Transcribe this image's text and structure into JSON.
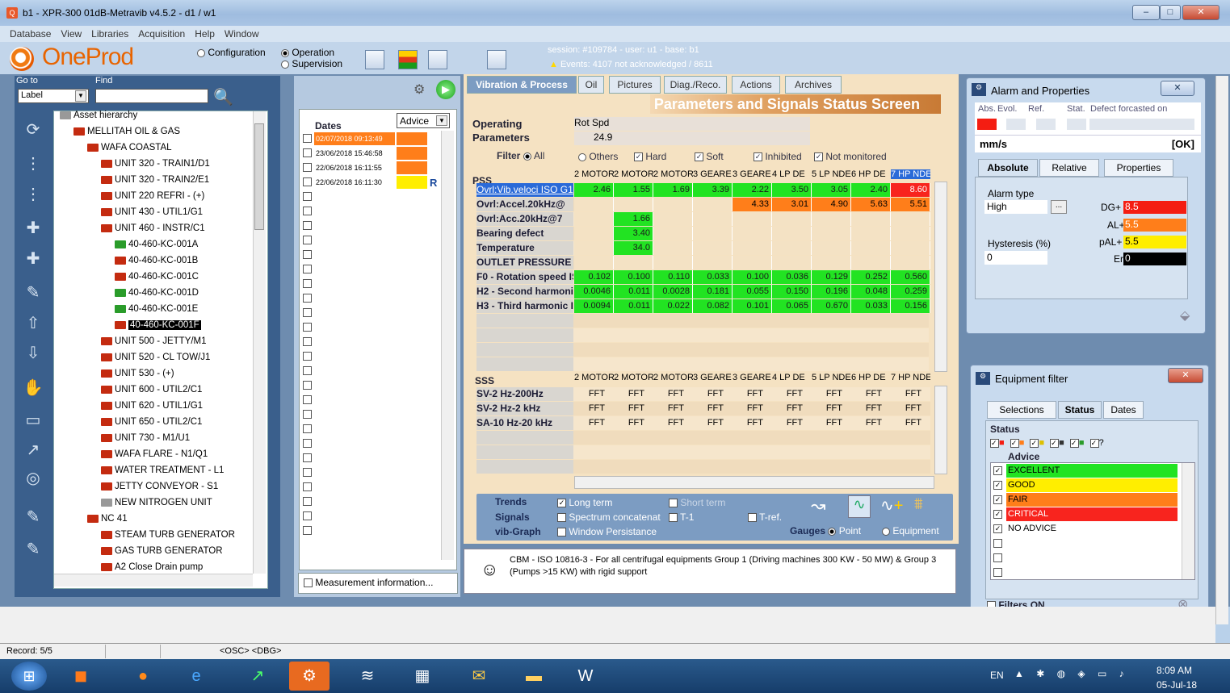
{
  "window": {
    "title": "b1 - XPR-300 01dB-Metravib v4.5.2 - d1 / w1"
  },
  "menu": [
    "Database",
    "View",
    "Libraries",
    "Acquisition",
    "Help",
    "Window"
  ],
  "logo": "OneProd",
  "mode": {
    "configuration": "Configuration",
    "operation": "Operation",
    "supervision": "Supervision"
  },
  "session": {
    "info": "session: #109784 - user: u1 - base: b1",
    "events": "Events: 4107 not acknowledged / 8611"
  },
  "goto": {
    "label": "Go to",
    "find": "Find",
    "select": "Label"
  },
  "tree": [
    {
      "label": "Asset hierarchy",
      "indent": 0,
      "color": "#999"
    },
    {
      "label": "MELLITAH OIL & GAS",
      "indent": 1,
      "color": "#c42b10"
    },
    {
      "label": "WAFA COASTAL",
      "indent": 2,
      "color": "#c42b10"
    },
    {
      "label": "UNIT 320 - TRAIN1/D1",
      "indent": 3,
      "color": "#c42b10"
    },
    {
      "label": "UNIT 320 - TRAIN2/E1",
      "indent": 3,
      "color": "#c42b10"
    },
    {
      "label": "UNIT 220 REFRI - (+)",
      "indent": 3,
      "color": "#c42b10"
    },
    {
      "label": "UNIT 430 - UTIL1/G1",
      "indent": 3,
      "color": "#c42b10"
    },
    {
      "label": "UNIT 460 - INSTR/C1",
      "indent": 3,
      "color": "#c42b10"
    },
    {
      "label": "40-460-KC-001A",
      "indent": 4,
      "color": "#2a9c2a"
    },
    {
      "label": "40-460-KC-001B",
      "indent": 4,
      "color": "#c42b10"
    },
    {
      "label": "40-460-KC-001C",
      "indent": 4,
      "color": "#c42b10"
    },
    {
      "label": "40-460-KC-001D",
      "indent": 4,
      "color": "#2a9c2a"
    },
    {
      "label": "40-460-KC-001E",
      "indent": 4,
      "color": "#2a9c2a"
    },
    {
      "label": "40-460-KC-001F",
      "indent": 4,
      "color": "#c42b10",
      "selected": true
    },
    {
      "label": "UNIT 500 - JETTY/M1",
      "indent": 3,
      "color": "#c42b10"
    },
    {
      "label": "UNIT 520 - CL TOW/J1",
      "indent": 3,
      "color": "#c42b10"
    },
    {
      "label": "UNIT 530 - (+)",
      "indent": 3,
      "color": "#c42b10"
    },
    {
      "label": "UNIT 600 - UTIL2/C1",
      "indent": 3,
      "color": "#c42b10"
    },
    {
      "label": "UNIT 620 - UTIL1/G1",
      "indent": 3,
      "color": "#c42b10"
    },
    {
      "label": "UNIT 650 - UTIL2/C1",
      "indent": 3,
      "color": "#c42b10"
    },
    {
      "label": "UNIT 730 - M1/U1",
      "indent": 3,
      "color": "#c42b10"
    },
    {
      "label": "WAFA FLARE - N1/Q1",
      "indent": 3,
      "color": "#c42b10"
    },
    {
      "label": "WATER TREATMENT - L1",
      "indent": 3,
      "color": "#c42b10"
    },
    {
      "label": "JETTY CONVEYOR - S1",
      "indent": 3,
      "color": "#c42b10"
    },
    {
      "label": "NEW NITROGEN UNIT",
      "indent": 3,
      "color": "#999"
    },
    {
      "label": "NC 41",
      "indent": 2,
      "color": "#c42b10"
    },
    {
      "label": "STEAM TURB GENERATOR",
      "indent": 3,
      "color": "#c42b10"
    },
    {
      "label": "GAS TURB GENERATOR",
      "indent": 3,
      "color": "#c42b10"
    },
    {
      "label": "A2 Close Drain pump",
      "indent": 3,
      "color": "#c42b10"
    }
  ],
  "dates": {
    "header": "Dates",
    "advice": "Advice",
    "rows": [
      {
        "date": "02/07/2018 09:13:49",
        "color": "#ff7e1a",
        "selected": true
      },
      {
        "date": "23/06/2018 15:46:58",
        "color": "#ff7e1a"
      },
      {
        "date": "22/06/2018 16:11:55",
        "color": "#ff7e1a"
      },
      {
        "date": "22/06/2018 16:11:30",
        "color": "#ffee00",
        "mark": "R"
      }
    ],
    "measurement_info": "Measurement information..."
  },
  "tabs": [
    "Vibration & Process",
    "Oil",
    "Pictures",
    "Diag./Reco.",
    "Actions",
    "Archives"
  ],
  "screen_title": "Parameters and Signals Status Screen",
  "operating": {
    "label1": "Operating",
    "label2": "Parameters",
    "param": "Rot Spd",
    "value": "24.9"
  },
  "filter": {
    "label": "Filter",
    "all": "All",
    "others": "Others",
    "hard": "Hard",
    "soft": "Soft",
    "inhibited": "Inhibited",
    "not_monitored": "Not monitored"
  },
  "pss": {
    "label": "PSS",
    "columns": [
      "2 MOTOR",
      "2 MOTOR",
      "2 MOTOR",
      "3 GEARE",
      "3 GEARE",
      "4 LP DE",
      "5 LP NDE",
      "6 HP DE",
      "7 HP NDE"
    ],
    "rows": [
      {
        "label": "Ovrl:Vib.veloci ISO G1",
        "values": [
          "2.46",
          "1.55",
          "1.69",
          "3.39",
          "2.22",
          "3.50",
          "3.05",
          "2.40",
          "8.60"
        ],
        "classes": [
          "g",
          "g",
          "g",
          "g",
          "g",
          "g",
          "g",
          "g",
          "r"
        ]
      },
      {
        "label": "Ovrl:Accel.20kHz@",
        "values": [
          "",
          "",
          "",
          "",
          "4.33",
          "3.01",
          "4.90",
          "5.63",
          "5.51"
        ],
        "classes": [
          "",
          "",
          "",
          "",
          "o",
          "o",
          "o",
          "o",
          "o"
        ]
      },
      {
        "label": "Ovrl:Acc.20kHz@7",
        "values": [
          "",
          "1.66",
          "",
          "",
          "",
          "",
          "",
          "",
          ""
        ],
        "classes": [
          "",
          "g",
          "",
          "",
          "",
          "",
          "",
          "",
          ""
        ]
      },
      {
        "label": "Bearing defect",
        "values": [
          "",
          "3.40",
          "",
          "",
          "",
          "",
          "",
          "",
          ""
        ],
        "classes": [
          "",
          "g",
          "",
          "",
          "",
          "",
          "",
          "",
          ""
        ]
      },
      {
        "label": "Temperature",
        "values": [
          "",
          "34.0",
          "",
          "",
          "",
          "",
          "",
          "",
          ""
        ],
        "classes": [
          "",
          "g",
          "",
          "",
          "",
          "",
          "",
          "",
          ""
        ]
      },
      {
        "label": "OUTLET PRESSURE",
        "values": [
          "",
          "",
          "",
          "",
          "",
          "",
          "",
          "",
          ""
        ],
        "classes": [
          "",
          "",
          "",
          "",
          "",
          "",
          "",
          "",
          ""
        ]
      },
      {
        "label": "F0 - Rotation speed IS",
        "values": [
          "0.102",
          "0.100",
          "0.110",
          "0.033",
          "0.100",
          "0.036",
          "0.129",
          "0.252",
          "0.560"
        ],
        "classes": [
          "g",
          "g",
          "g",
          "g",
          "g",
          "g",
          "g",
          "g",
          "g"
        ]
      },
      {
        "label": "H2 - Second harmonic",
        "values": [
          "0.0046",
          "0.011",
          "0.0028",
          "0.181",
          "0.055",
          "0.150",
          "0.196",
          "0.048",
          "0.259"
        ],
        "classes": [
          "g",
          "g",
          "g",
          "g",
          "g",
          "g",
          "g",
          "g",
          "g"
        ]
      },
      {
        "label": "H3 - Third harmonic IS",
        "values": [
          "0.0094",
          "0.011",
          "0.022",
          "0.082",
          "0.101",
          "0.065",
          "0.670",
          "0.033",
          "0.156"
        ],
        "classes": [
          "g",
          "g",
          "g",
          "g",
          "g",
          "g",
          "g",
          "g",
          "g"
        ]
      }
    ]
  },
  "sss": {
    "label": "SSS",
    "rows": [
      {
        "label": "SV-2 Hz-200Hz",
        "value": "FFT"
      },
      {
        "label": "SV-2 Hz-2 kHz",
        "value": "FFT"
      },
      {
        "label": "SA-10 Hz-20 kHz",
        "value": "FFT"
      }
    ]
  },
  "bottom": {
    "trends": "Trends",
    "signals": "Signals",
    "vibgraph": "vib-Graph",
    "long_term": "Long term",
    "short_term": "Short term",
    "spectrum": "Spectrum concatenat",
    "t1": "T-1",
    "tref": "T-ref.",
    "window": "Window Persistance",
    "gauges": "Gauges",
    "point": "Point",
    "equipment": "Equipment"
  },
  "cbm": "CBM - ISO 10816-3 - For all centrifugal equipments Group 1 (Driving machines 300 KW - 50 MW) & Group 3 (Pumps >15 KW) with rigid support",
  "alarm": {
    "title": "Alarm and Properties",
    "cols": [
      "Abs.",
      "Evol.",
      "Ref.",
      "Stat.",
      "Defect forcasted on"
    ],
    "unit": "mm/s",
    "status": "[OK]",
    "tabs": [
      "Absolute",
      "Relative",
      "Properties"
    ],
    "alarm_type_label": "Alarm type",
    "alarm_type": "High",
    "hysteresis_label": "Hysteresis (%)",
    "hysteresis": "0",
    "dg_label": "DG+",
    "dg": "8.5",
    "al_label": "AL+",
    "al": "5.5",
    "pal_label": "pAL+",
    "pal": "5.5",
    "err_label": "Err",
    "err": "0"
  },
  "eqfilter": {
    "title": "Equipment filter",
    "tabs": [
      "Selections",
      "Status",
      "Dates"
    ],
    "status_label": "Status",
    "advice_label": "Advice",
    "advice": [
      {
        "label": "EXCELLENT",
        "color": "#22e322"
      },
      {
        "label": "GOOD",
        "color": "#ffee00"
      },
      {
        "label": "FAIR",
        "color": "#ff7e1a"
      },
      {
        "label": "CRITICAL",
        "color": "#f8241e"
      },
      {
        "label": "NO ADVICE",
        "color": "#ffffff"
      }
    ],
    "filters_on": "Filters ON"
  },
  "statusbar": {
    "record": "Record: 5/5",
    "tags": "<OSC> <DBG>"
  },
  "taskbar": {
    "lang": "EN",
    "time": "8:09 AM",
    "date": "05-Jul-18"
  }
}
